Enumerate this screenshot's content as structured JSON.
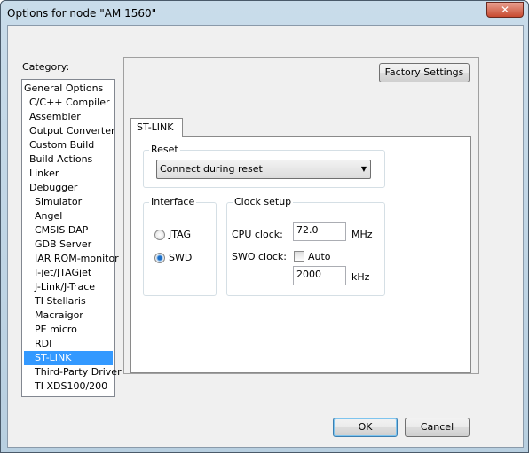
{
  "window": {
    "title": "Options for node \"AM 1560\"",
    "close_glyph": "✕"
  },
  "category": {
    "label": "Category:",
    "items": [
      {
        "label": "General Options",
        "level": 0
      },
      {
        "label": "C/C++ Compiler",
        "level": 1
      },
      {
        "label": "Assembler",
        "level": 1
      },
      {
        "label": "Output Converter",
        "level": 1
      },
      {
        "label": "Custom Build",
        "level": 1
      },
      {
        "label": "Build Actions",
        "level": 1
      },
      {
        "label": "Linker",
        "level": 1
      },
      {
        "label": "Debugger",
        "level": 1
      },
      {
        "label": "Simulator",
        "level": 2
      },
      {
        "label": "Angel",
        "level": 2
      },
      {
        "label": "CMSIS DAP",
        "level": 2
      },
      {
        "label": "GDB Server",
        "level": 2
      },
      {
        "label": "IAR ROM-monitor",
        "level": 2
      },
      {
        "label": "I-jet/JTAGjet",
        "level": 2
      },
      {
        "label": "J-Link/J-Trace",
        "level": 2
      },
      {
        "label": "TI Stellaris",
        "level": 2
      },
      {
        "label": "Macraigor",
        "level": 2
      },
      {
        "label": "PE micro",
        "level": 2
      },
      {
        "label": "RDI",
        "level": 2
      },
      {
        "label": "ST-LINK",
        "level": 2,
        "selected": true
      },
      {
        "label": "Third-Party Driver",
        "level": 2
      },
      {
        "label": "TI XDS100/200",
        "level": 2
      }
    ]
  },
  "factory_settings": "Factory Settings",
  "tab": "ST-LINK",
  "reset": {
    "label": "Reset",
    "value": "Connect during reset"
  },
  "interface": {
    "label": "Interface",
    "options": [
      {
        "label": "JTAG",
        "checked": false
      },
      {
        "label": "SWD",
        "checked": true
      }
    ]
  },
  "clock": {
    "label": "Clock setup",
    "cpu_label": "CPU clock:",
    "cpu_value": "72.0",
    "cpu_unit": "MHz",
    "swo_label": "SWO clock:",
    "auto_label": "Auto",
    "auto_checked": false,
    "swo_value": "2000",
    "swo_unit": "kHz"
  },
  "buttons": {
    "ok": "OK",
    "cancel": "Cancel"
  },
  "colors": {
    "selection": "#3399ff"
  }
}
